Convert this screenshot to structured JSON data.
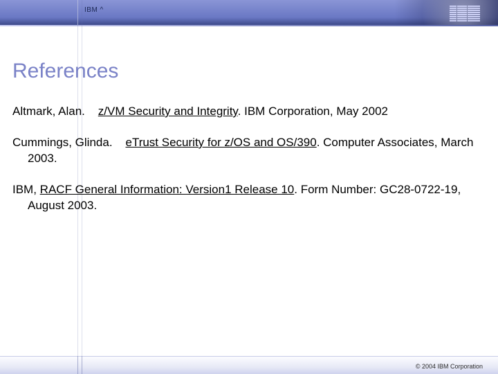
{
  "header": {
    "product_label": "IBM ^"
  },
  "title": "References",
  "references": {
    "r1": {
      "author": "Altmark, Alan.",
      "title": "z/VM Security and Integrity",
      "rest": ". IBM  Corporation, May 2002"
    },
    "r2": {
      "author": "Cummings, Glinda.",
      "title": "eTrust Security for z/OS and OS/390",
      "rest": ".  Computer Associates, March 2003."
    },
    "r3": {
      "author": "IBM, ",
      "title": "RACF General Information: Version1 Release 10",
      "rest": ".  Form Number: GC28-0722-19, August 2003."
    }
  },
  "footer": {
    "copyright": "© 2004 IBM Corporation"
  }
}
